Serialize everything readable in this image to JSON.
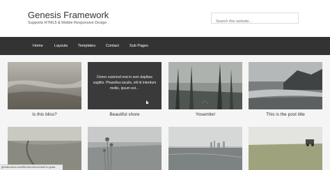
{
  "header": {
    "site_title": "Genesis Framework",
    "site_description": "Supports HTML5 & Mobile Responsive Design",
    "search_placeholder": "Search this website…"
  },
  "nav": {
    "items": [
      "Home",
      "Layouts",
      "Templates",
      "Contact",
      "Sub Pages"
    ]
  },
  "posts": [
    {
      "caption": "Is this bliss?"
    },
    {
      "caption": "Beautiful shore",
      "overlay_text": "Donec euismod erat in sem dapibus sagittis. Phasellus iaculis, elit id interdum mollis, ipsum est…"
    },
    {
      "caption": "Yosemite!"
    },
    {
      "caption": "This is the post title"
    },
    {
      "caption": ""
    },
    {
      "caption": ""
    },
    {
      "caption": ""
    },
    {
      "caption": ""
    }
  ],
  "status_bar": {
    "text": "genesis-demo.com/this-first-shot-at-stuff-on-grass-fixtures"
  },
  "colors": {
    "nav_bg": "#333333",
    "page_bg": "#f5f5f5"
  }
}
